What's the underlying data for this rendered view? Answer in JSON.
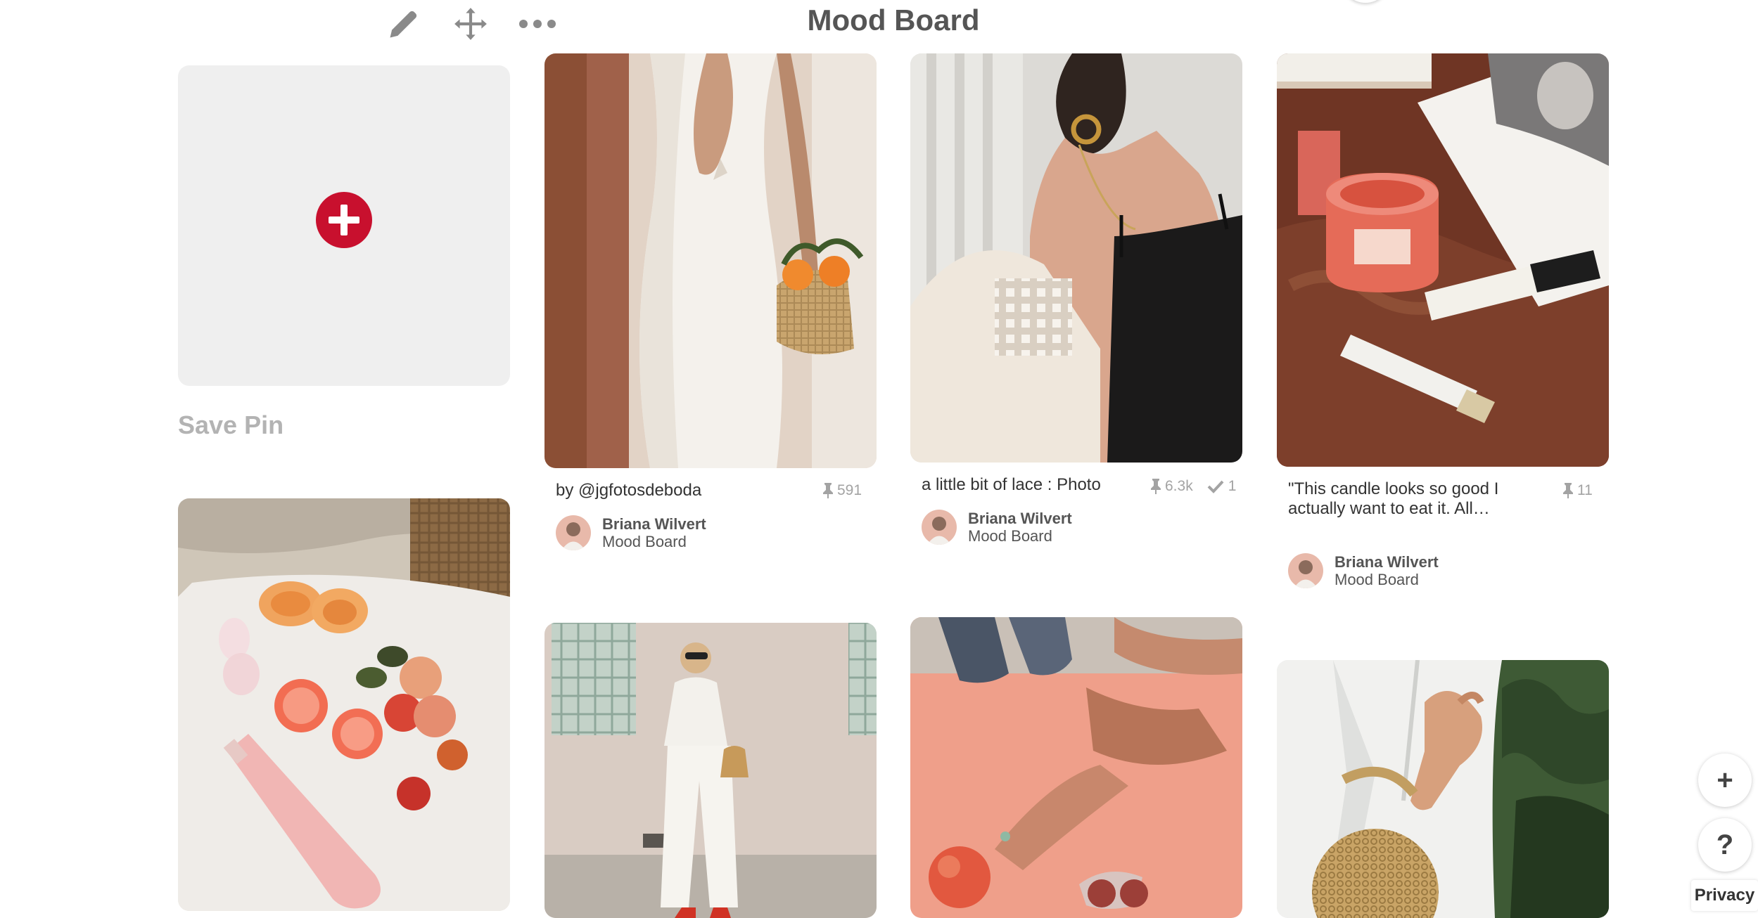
{
  "header": {
    "board_title": "Mood Board",
    "icons": [
      "pencil-icon",
      "move-icon",
      "more-icon"
    ]
  },
  "add_pin": {
    "icon": "plus-icon",
    "label": "Save Pin",
    "accent_color": "#c8102e"
  },
  "pins": [
    {
      "description": "by @jgfotosdeboda",
      "saves": "591",
      "tried": "",
      "saver_name": "Briana Wilvert",
      "board": "Mood Board"
    },
    {
      "description": "a little bit of lace : Photo",
      "saves": "6.3k",
      "tried": "1",
      "saver_name": "Briana Wilvert",
      "board": "Mood Board"
    },
    {
      "description": "\"This candle looks so good I actually want to eat it. All…",
      "saves": "11",
      "tried": "",
      "saver_name": "Briana Wilvert",
      "board": "Mood Board"
    }
  ],
  "image_subjects": [
    "white-dress-basket-image",
    "black-top-lace-image",
    "candle-basalt-image",
    "picnic-fruit-image",
    "white-outfit-street-image",
    "pink-towel-peach-image",
    "linen-shirt-bag-image"
  ],
  "floating": {
    "add_label": "+",
    "help_label": "?",
    "privacy_label": "Privacy"
  }
}
